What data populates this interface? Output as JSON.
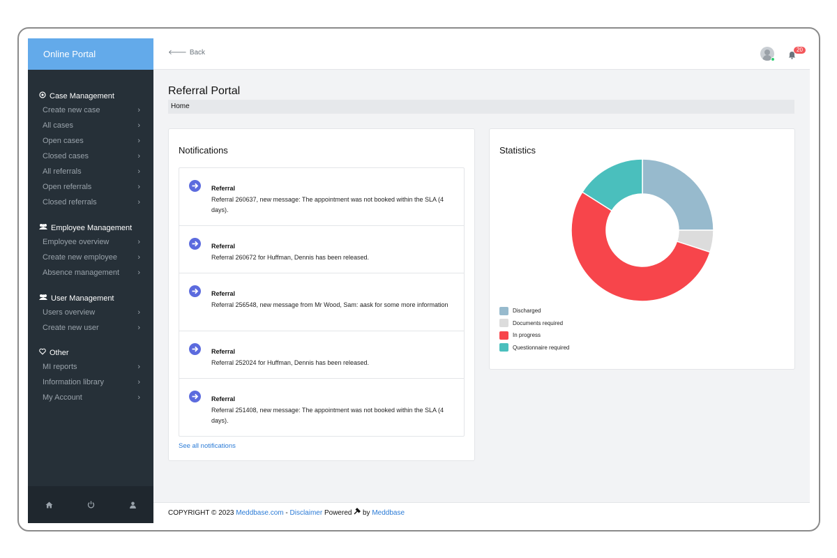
{
  "app": {
    "brand": "Online Portal"
  },
  "sidebar": {
    "sections": [
      {
        "title": "Case Management",
        "icon": "target-icon",
        "items": [
          "Create new case",
          "All cases",
          "Open cases",
          "Closed cases",
          "All referrals",
          "Open referrals",
          "Closed referrals"
        ]
      },
      {
        "title": "Employee Management",
        "icon": "users-icon",
        "items": [
          "Employee overview",
          "Create new employee",
          "Absence management"
        ]
      },
      {
        "title": "User Management",
        "icon": "users-icon",
        "items": [
          "Users overview",
          "Create new user"
        ]
      },
      {
        "title": "Other",
        "icon": "heart-icon",
        "items": [
          "MI reports",
          "Information library",
          "My Account"
        ]
      }
    ],
    "footer_icons": [
      "home-icon",
      "power-icon",
      "user-icon"
    ]
  },
  "topbar": {
    "back_label": "Back",
    "notification_count": "20"
  },
  "page": {
    "title": "Referral Portal",
    "breadcrumb": "Home"
  },
  "notifications": {
    "title": "Notifications",
    "items": [
      {
        "title": "Referral",
        "message": "Referral 260637, new message: The appointment was not booked within the SLA (4 days)."
      },
      {
        "title": "Referral",
        "message": "Referral 260672 for Huffman, Dennis has been released."
      },
      {
        "title": "Referral",
        "message": "Referral 256548, new message from Mr Wood, Sam: aask for some more information"
      },
      {
        "title": "Referral",
        "message": "Referral 252024 for Huffman, Dennis has been released."
      },
      {
        "title": "Referral",
        "message": "Referral 251408, new message: The appointment was not booked within the SLA (4 days)."
      }
    ],
    "see_all": "See all notifications"
  },
  "statistics": {
    "title": "Statistics"
  },
  "chart_data": {
    "type": "pie",
    "title": "",
    "categories": [
      "Discharged",
      "Documents required",
      "In progress",
      "Questionnaire required"
    ],
    "values": [
      25,
      5,
      54,
      16
    ],
    "colors": [
      "#97bacd",
      "#dcdcdc",
      "#f7454b",
      "#4abfbd"
    ],
    "legend": "bottom-left"
  },
  "footer": {
    "copyright": "COPYRIGHT © 2023",
    "site_link": "Meddbase.com",
    "separator": "-",
    "disclaimer": "Disclaimer",
    "powered": "Powered",
    "by": "by",
    "brand_link": "Meddbase"
  }
}
